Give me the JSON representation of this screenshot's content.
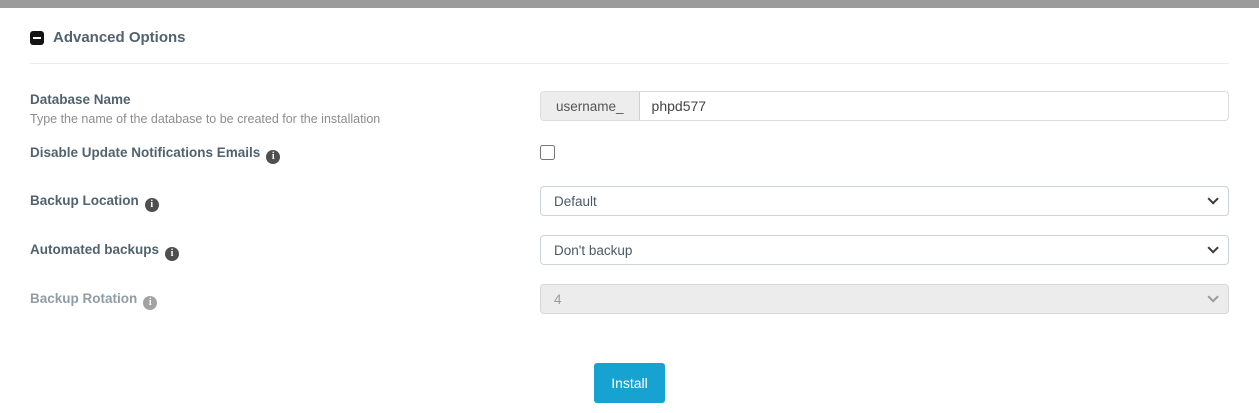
{
  "panel": {
    "title": "Advanced Options",
    "collapse_icon": "minus-square-icon"
  },
  "fields": {
    "database_name": {
      "label": "Database Name",
      "help": "Type the name of the database to be created for the installation",
      "prefix": "username_",
      "value": "phpd577"
    },
    "disable_update_emails": {
      "label": "Disable Update Notifications Emails",
      "info_icon": "info-icon",
      "checked": false
    },
    "backup_location": {
      "label": "Backup Location",
      "info_icon": "info-icon",
      "value": "Default"
    },
    "automated_backups": {
      "label": "Automated backups",
      "info_icon": "info-icon",
      "value": "Don't backup"
    },
    "backup_rotation": {
      "label": "Backup Rotation",
      "info_icon": "info-icon",
      "value": "4",
      "disabled": true
    }
  },
  "actions": {
    "install_label": "Install"
  },
  "colors": {
    "accent_button": "#17a3d1",
    "label_text": "#51626f",
    "top_bar": "#9b9b9b",
    "disabled_field_bg": "#ececec"
  }
}
